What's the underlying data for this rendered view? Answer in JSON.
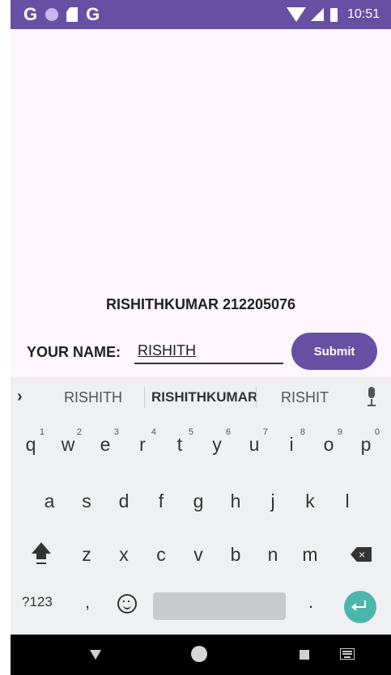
{
  "status_bar": {
    "left_icons": [
      "google-icon",
      "circle-icon",
      "sd-card-icon",
      "google-icon"
    ],
    "google_glyph": "G",
    "right_icons": [
      "wifi-icon",
      "cell-signal-icon",
      "battery-icon"
    ],
    "time": "10:51",
    "color": "#6750a4"
  },
  "app": {
    "title": "RISHITHKUMAR 212205076",
    "name_label": "YOUR NAME:",
    "name_value": "RISHITH",
    "submit_label": "Submit",
    "background": "#fdf6fe",
    "accent": "#6750a4"
  },
  "keyboard": {
    "suggestions": [
      "RISHITH",
      "RISHITHKUMAR",
      "RISHIT"
    ],
    "expand_glyph": "›",
    "row1": [
      {
        "key": "q",
        "hint": "1"
      },
      {
        "key": "w",
        "hint": "2"
      },
      {
        "key": "e",
        "hint": "3"
      },
      {
        "key": "r",
        "hint": "4"
      },
      {
        "key": "t",
        "hint": "5"
      },
      {
        "key": "y",
        "hint": "6"
      },
      {
        "key": "u",
        "hint": "7"
      },
      {
        "key": "i",
        "hint": "8"
      },
      {
        "key": "o",
        "hint": "9"
      },
      {
        "key": "p",
        "hint": "0"
      }
    ],
    "row2": [
      "a",
      "s",
      "d",
      "f",
      "g",
      "h",
      "j",
      "k",
      "l"
    ],
    "row3": [
      "z",
      "x",
      "c",
      "v",
      "b",
      "n",
      "m"
    ],
    "symbols_label": "?123",
    "comma": ",",
    "period": ".",
    "backspace_glyph": "×",
    "enter_color": "#4db6ac"
  },
  "nav_bar": {
    "icons": [
      "back-icon",
      "home-icon",
      "recents-icon",
      "keyboard-icon"
    ]
  }
}
